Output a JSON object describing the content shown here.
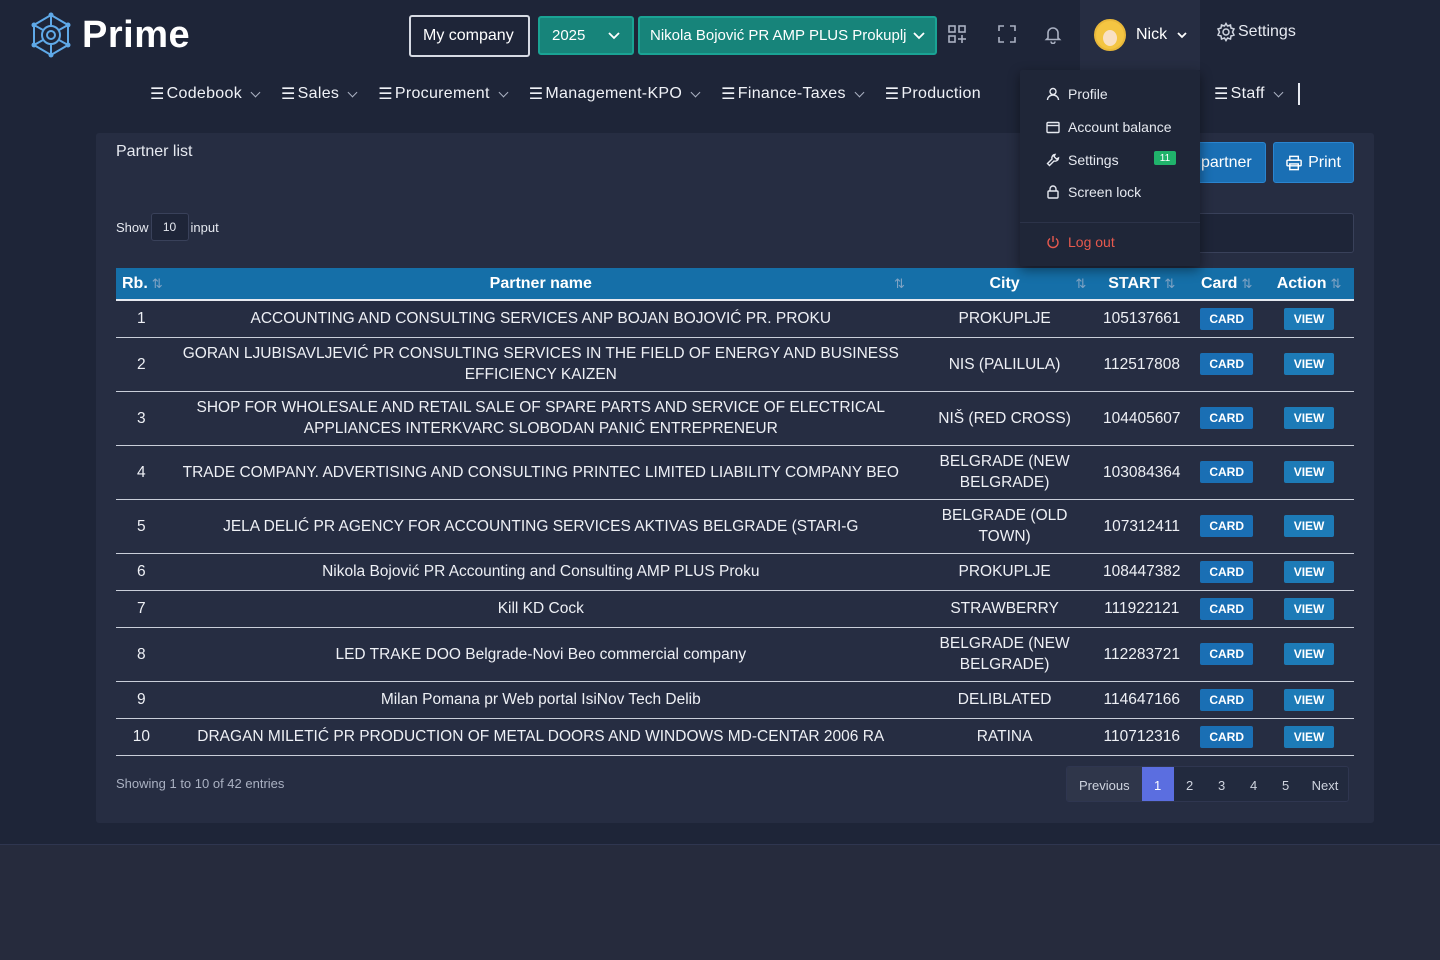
{
  "app": {
    "name": "Prime"
  },
  "header": {
    "company_button": "My company",
    "year_select": "2025",
    "company_select": "Nikola Bojović PR AMP PLUS Prokuplj",
    "user_name": "Nick",
    "settings_label": "Settings"
  },
  "nav": [
    {
      "label": "Codebook"
    },
    {
      "label": "Sales"
    },
    {
      "label": "Procurement"
    },
    {
      "label": "Management-KPO"
    },
    {
      "label": "Finance-Taxes"
    },
    {
      "label": "Production"
    },
    {
      "label": "Staff"
    }
  ],
  "user_menu": {
    "profile": "Profile",
    "account_balance": "Account balance",
    "settings": "Settings",
    "settings_badge": "11",
    "screen_lock": "Screen lock",
    "logout": "Log out"
  },
  "page": {
    "title": "Partner list",
    "add_partner_button": "partner",
    "print_button": "Print",
    "show_label": "Show",
    "page_size": "10",
    "input_label": "input"
  },
  "table": {
    "headers": {
      "rb": "Rb.",
      "partner": "Partner name",
      "city": "City",
      "start": "START",
      "card": "Card",
      "action": "Action"
    },
    "card_label": "CARD",
    "view_label": "VIEW",
    "rows": [
      {
        "rb": "1",
        "name": "ACCOUNTING AND CONSULTING SERVICES ANP BOJAN BOJOVIĆ PR. PROKU",
        "city": "PROKUPLJE",
        "start": "105137661"
      },
      {
        "rb": "2",
        "name": "GORAN LJUBISAVLJEVIĆ PR CONSULTING SERVICES IN THE FIELD OF ENERGY AND BUSINESS EFFICIENCY KAIZEN",
        "city": "NIS (PALILULA)",
        "start": "112517808"
      },
      {
        "rb": "3",
        "name": "SHOP FOR WHOLESALE AND RETAIL SALE OF SPARE PARTS AND SERVICE OF ELECTRICAL APPLIANCES INTERKVARC SLOBODAN PANIĆ ENTREPRENEUR",
        "city": "NIŠ (RED CROSS)",
        "start": "104405607"
      },
      {
        "rb": "4",
        "name": "TRADE COMPANY. ADVERTISING AND CONSULTING PRINTEC LIMITED LIABILITY COMPANY BEO",
        "city": "BELGRADE (NEW BELGRADE)",
        "start": "103084364"
      },
      {
        "rb": "5",
        "name": "JELA DELIĆ PR AGENCY FOR ACCOUNTING SERVICES AKTIVAS BELGRADE (STARI-G",
        "city": "BELGRADE (OLD TOWN)",
        "start": "107312411"
      },
      {
        "rb": "6",
        "name": "Nikola Bojović PR Accounting and Consulting AMP PLUS Proku",
        "city": "PROKUPLJE",
        "start": "108447382"
      },
      {
        "rb": "7",
        "name": "Kill KD Cock",
        "city": "STRAWBERRY",
        "start": "111922121"
      },
      {
        "rb": "8",
        "name": "LED TRAKE DOO Belgrade-Novi Beo commercial company",
        "city": "BELGRADE (NEW BELGRADE)",
        "start": "112283721"
      },
      {
        "rb": "9",
        "name": "Milan Pomana pr Web portal IsiNov Tech Delib",
        "city": "DELIBLATED",
        "start": "114647166"
      },
      {
        "rb": "10",
        "name": "DRAGAN MILETIĆ PR PRODUCTION OF METAL DOORS AND WINDOWS MD-CENTAR 2006 RA",
        "city": "RATINA",
        "start": "110712316"
      }
    ]
  },
  "footer": {
    "showing": "Showing 1 to 10 of 42 entries",
    "previous": "Previous",
    "pages": [
      "1",
      "2",
      "3",
      "4",
      "5"
    ],
    "active_page": "1",
    "next": "Next"
  },
  "colors": {
    "accent_teal": "#17847a",
    "accent_blue": "#1a6fb4",
    "table_header": "#156fa8",
    "active_page": "#5b6ee0",
    "logout": "#e6594e"
  }
}
